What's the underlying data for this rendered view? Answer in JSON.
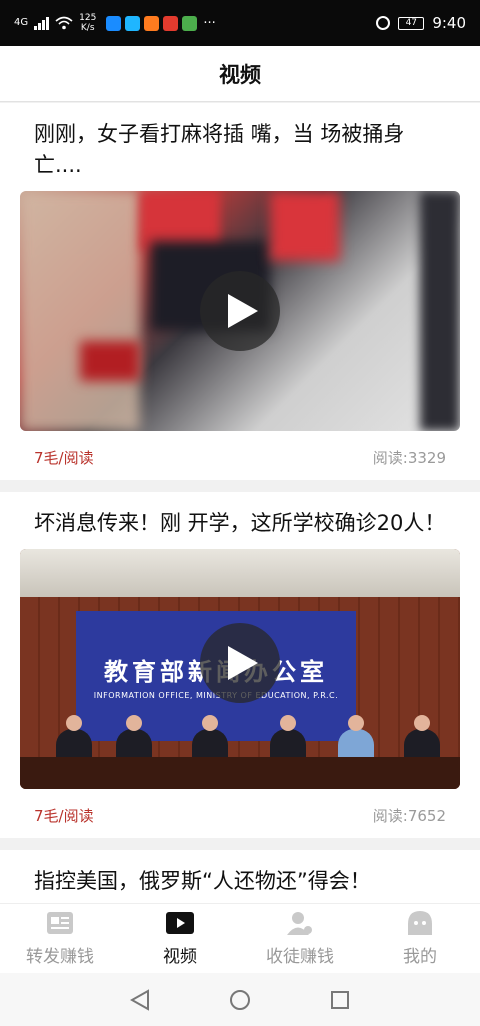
{
  "status_bar": {
    "network": "4G",
    "speed": "125\nK/s",
    "battery": "47",
    "time": "9:40",
    "more": "···"
  },
  "header": {
    "title": "视频"
  },
  "feed": [
    {
      "title": "刚刚，女子看打麻将插 嘴，当 场被捅身亡....",
      "reward": "7毛/阅读",
      "reads": "阅读:3329"
    },
    {
      "title": "坏消息传来！刚 开学，这所学校确诊20人！",
      "reward": "7毛/阅读",
      "reads": "阅读:7652",
      "banner_cn": "教育部新闻办公室",
      "banner_en": "INFORMATION OFFICE, MINISTRY OF EDUCATION, P.R.C."
    },
    {
      "title": "指控美国，俄罗斯“人还物还”得会！"
    }
  ],
  "tabbar": {
    "tabs": [
      {
        "label": "转发赚钱",
        "icon": "article-icon"
      },
      {
        "label": "视频",
        "icon": "video-icon"
      },
      {
        "label": "收徒赚钱",
        "icon": "user-icon"
      },
      {
        "label": "我的",
        "icon": "profile-icon"
      }
    ],
    "active": "视频"
  },
  "colors": {
    "accent": "#b9332c",
    "muted": "#9a9a9a",
    "active_tab": "#111111"
  }
}
